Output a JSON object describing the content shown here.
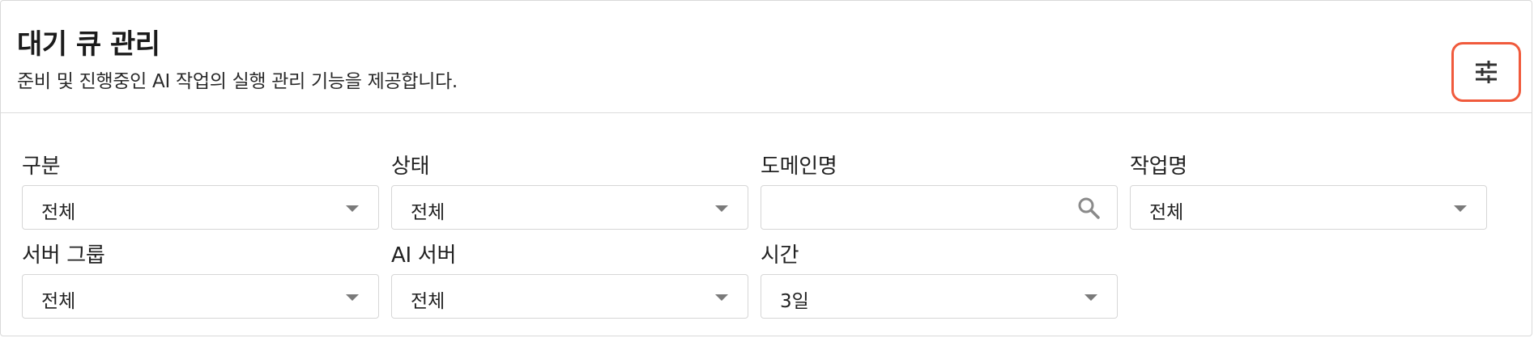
{
  "header": {
    "title": "대기 큐 관리",
    "subtitle": "준비 및 진행중인 AI 작업의 실행 관리 기능을 제공합니다.",
    "filter_icon": "sliders-icon",
    "accent_color": "#f05a3c"
  },
  "filters": {
    "category": {
      "label": "구분",
      "value": "전체"
    },
    "status": {
      "label": "상태",
      "value": "전체"
    },
    "domain": {
      "label": "도메인명",
      "value": "",
      "placeholder": "",
      "icon": "search-icon"
    },
    "job_name": {
      "label": "작업명",
      "value": "전체"
    },
    "server_group": {
      "label": "서버 그룹",
      "value": "전체"
    },
    "ai_server": {
      "label": "AI 서버",
      "value": "전체"
    },
    "time": {
      "label": "시간",
      "value": "3일"
    }
  }
}
